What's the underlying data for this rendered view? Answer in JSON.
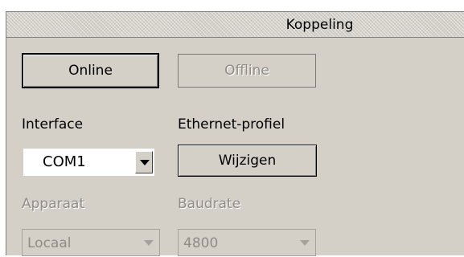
{
  "panel": {
    "title": "Koppeling"
  },
  "buttons": {
    "online": "Online",
    "offline": "Offline",
    "wijzigen": "Wijzigen"
  },
  "labels": {
    "interface": "Interface",
    "ethernet_profile": "Ethernet-profiel",
    "apparaat": "Apparaat",
    "baudrate": "Baudrate"
  },
  "selects": {
    "interface": {
      "value": "COM1",
      "enabled": true
    },
    "apparaat": {
      "value": "Locaal",
      "enabled": false
    },
    "baudrate": {
      "value": "4800",
      "enabled": false
    }
  },
  "colors": {
    "panel_bg": "#d4d0c8",
    "disabled_text": "#8f8c86"
  }
}
